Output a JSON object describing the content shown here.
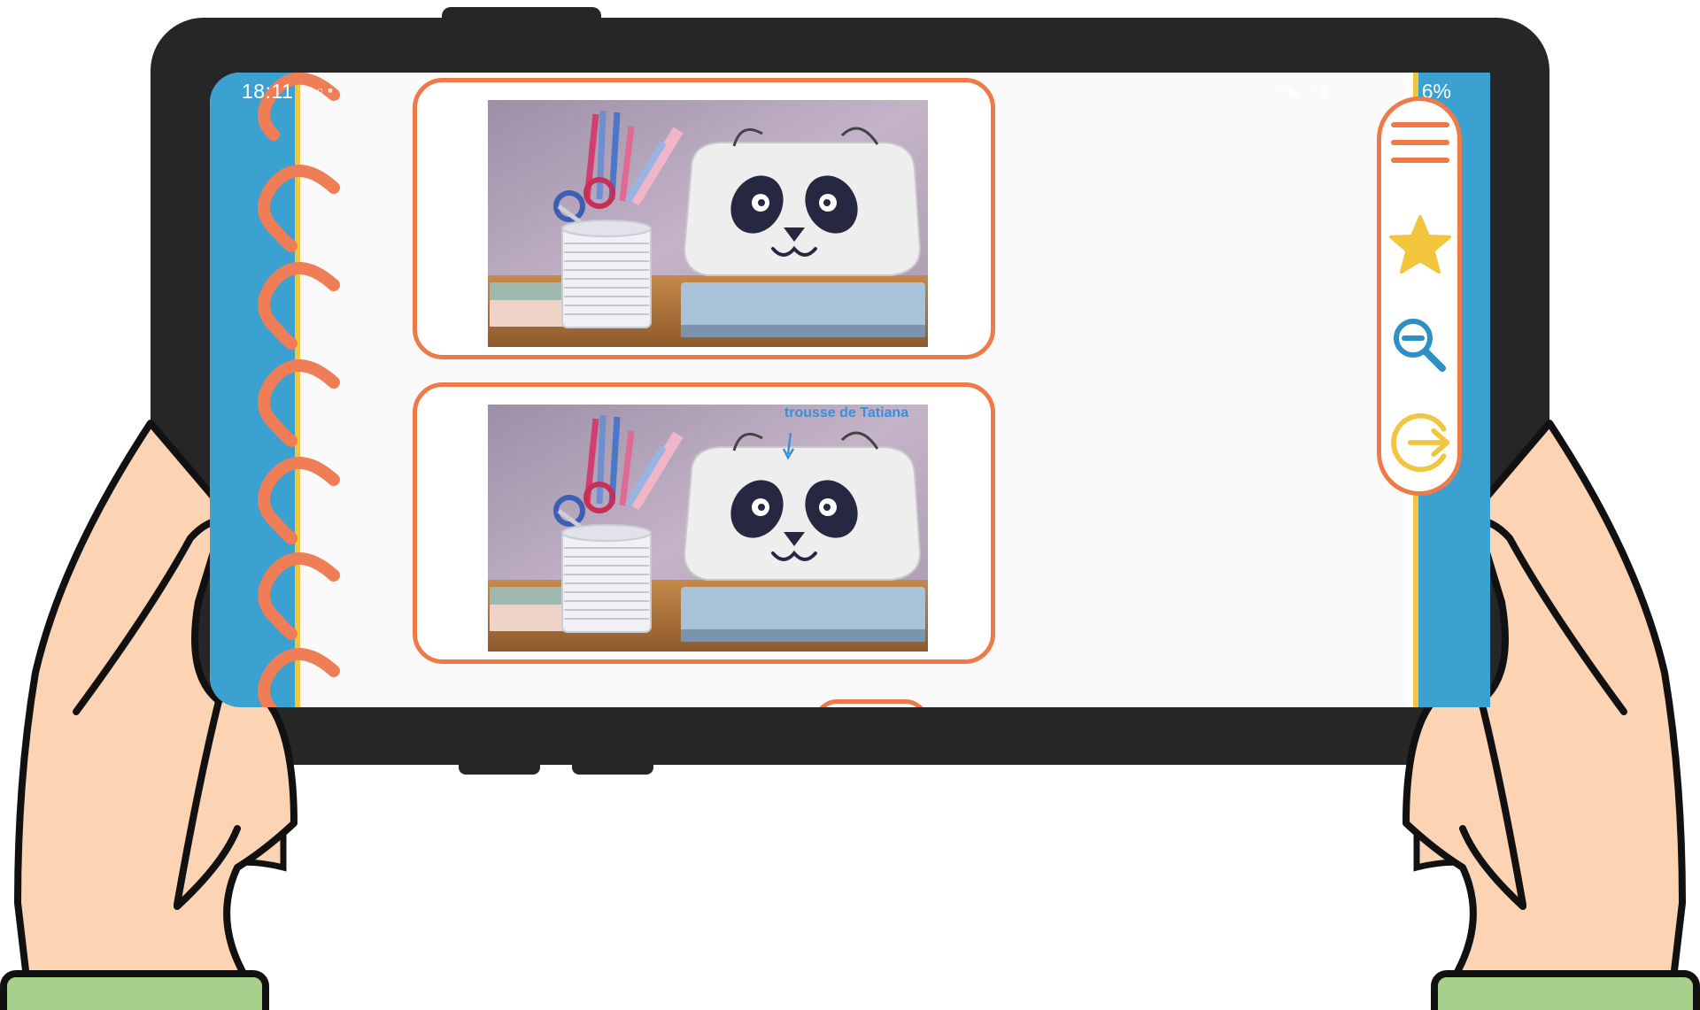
{
  "status_bar": {
    "time": "18:11",
    "battery": "6%"
  },
  "toolbar": {
    "menu_icon": "hamburger-menu-icon",
    "favorite_icon": "star-icon",
    "zoom_icon": "zoom-out-icon",
    "exit_icon": "arrow-exit-icon"
  },
  "cards": [
    {
      "image": "photo of pencil cup with scissors and panda pencil case on notebook",
      "annotation": ""
    },
    {
      "image": "same photo with annotation arrow pointing to panda pencil case",
      "annotation": "trousse de Tatiana"
    }
  ],
  "colors": {
    "accent_orange": "#ee7a48",
    "spine_blue": "#3ba1d0",
    "star_yellow": "#f2c53d",
    "zoom_blue": "#2f8fc4",
    "exit_yellow": "#f0c640",
    "annotation_blue": "#3a8fd6",
    "skin": "#fcd4b3",
    "sleeve_green": "#a7d08c",
    "tablet_frame": "#262626"
  }
}
